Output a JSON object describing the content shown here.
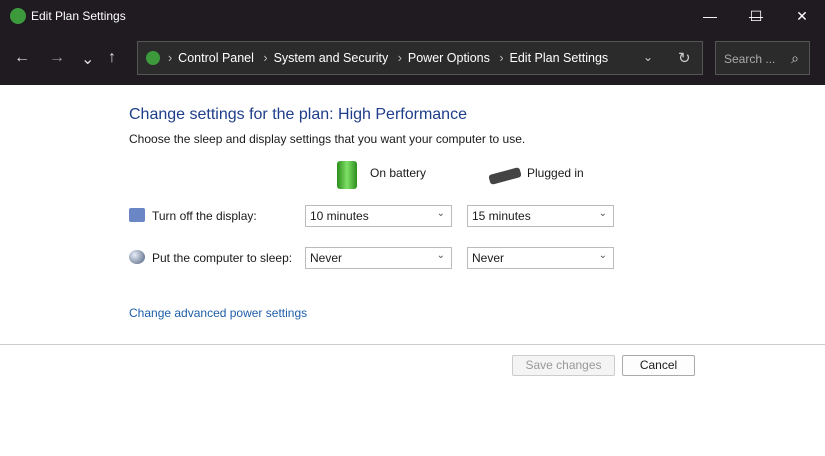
{
  "window": {
    "title": "Edit Plan Settings",
    "minimize": "—",
    "maximize": "☐",
    "close": "✕"
  },
  "nav": {
    "back": "←",
    "forward": "→",
    "recent": "⌄",
    "up": "↑",
    "dropdown": "⌄",
    "refresh": "↻",
    "breadcrumb": [
      "Control Panel",
      "System and Security",
      "Power Options",
      "Edit Plan Settings"
    ],
    "search_placeholder": "Search ...",
    "search_icon": "⌕"
  },
  "main": {
    "title": "Change settings for the plan: High Performance",
    "subtitle": "Choose the sleep and display settings that you want your computer to use.",
    "col_battery": "On battery",
    "col_plugged": "Plugged in",
    "rows": [
      {
        "label": "Turn off the display:",
        "battery": "10 minutes",
        "plugged": "15 minutes"
      },
      {
        "label": "Put the computer to sleep:",
        "battery": "Never",
        "plugged": "Never"
      }
    ],
    "advanced_link": "Change advanced power settings",
    "save": "Save changes",
    "cancel": "Cancel"
  }
}
